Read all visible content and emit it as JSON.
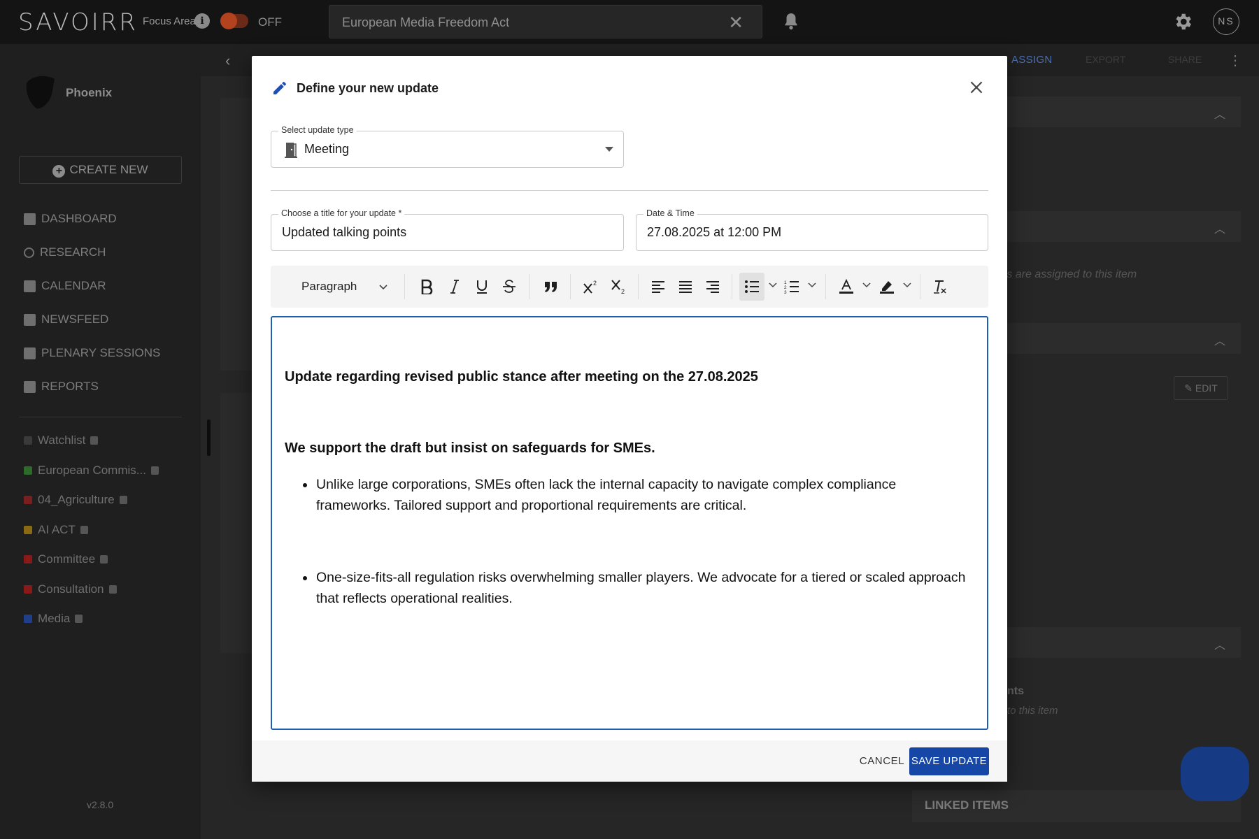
{
  "app": {
    "logo": "SAVOIRR",
    "focus_area_label": "Focus Area",
    "focus_area_state": "OFF",
    "search_value": "European Media Freedom Act",
    "avatar_initials": "NS",
    "version": "v2.8.0"
  },
  "sidebar": {
    "workspace_name": "Phoenix",
    "create_new_label": "CREATE NEW",
    "nav": [
      {
        "label": "DASHBOARD",
        "icon": "dashboard-icon"
      },
      {
        "label": "RESEARCH",
        "icon": "search-icon"
      },
      {
        "label": "CALENDAR",
        "icon": "calendar-icon"
      },
      {
        "label": "NEWSFEED",
        "icon": "newsfeed-icon"
      },
      {
        "label": "PLENARY SESSIONS",
        "icon": "plenary-icon"
      },
      {
        "label": "REPORTS",
        "icon": "reports-icon"
      }
    ],
    "lists": [
      {
        "label": "Watchlist",
        "color": "#3a3a3a"
      },
      {
        "label": "European Commis...",
        "color": "#2e6b2a"
      },
      {
        "label": "04_Agriculture",
        "color": "#7a1f1f"
      },
      {
        "label": "AI ACT",
        "color": "#8a6a12"
      },
      {
        "label": "Committee",
        "color": "#8a1a1a"
      },
      {
        "label": "Consultation",
        "color": "#8a1a1a"
      },
      {
        "label": "Media",
        "color": "#1f3f8a"
      }
    ]
  },
  "content": {
    "assign_label": "ASSIGN",
    "export_label": "EXPORT",
    "share_label": "SHARE",
    "edit_label": "EDIT",
    "linked_items_label": "LINKED ITEMS",
    "assigned_hint": "rs are assigned to this item",
    "comments_title": "nts",
    "comments_hint": "to this item"
  },
  "modal": {
    "title": "Define your new update",
    "update_type": {
      "label": "Select update type",
      "value": "Meeting",
      "icon": "door-icon"
    },
    "title_field": {
      "label": "Choose a title for your update *",
      "value": "Updated talking points"
    },
    "date_field": {
      "label": "Date & Time",
      "value": "27.08.2025 at 12:00 PM"
    },
    "toolbar": {
      "paragraph_label": "Paragraph"
    },
    "editor": {
      "heading1": "Update regarding revised public stance after meeting on the 27.08.2025",
      "heading2": "We support the draft but insist on safeguards for SMEs.",
      "bullets": [
        "Unlike large corporations, SMEs often lack the internal capacity to navigate complex compliance frameworks. Tailored support and proportional requirements are critical.",
        "One-size-fits-all regulation risks overwhelming smaller players. We advocate for a tiered or scaled approach that reflects operational realities."
      ]
    },
    "cancel_label": "CANCEL",
    "save_label": "SAVE UPDATE"
  }
}
